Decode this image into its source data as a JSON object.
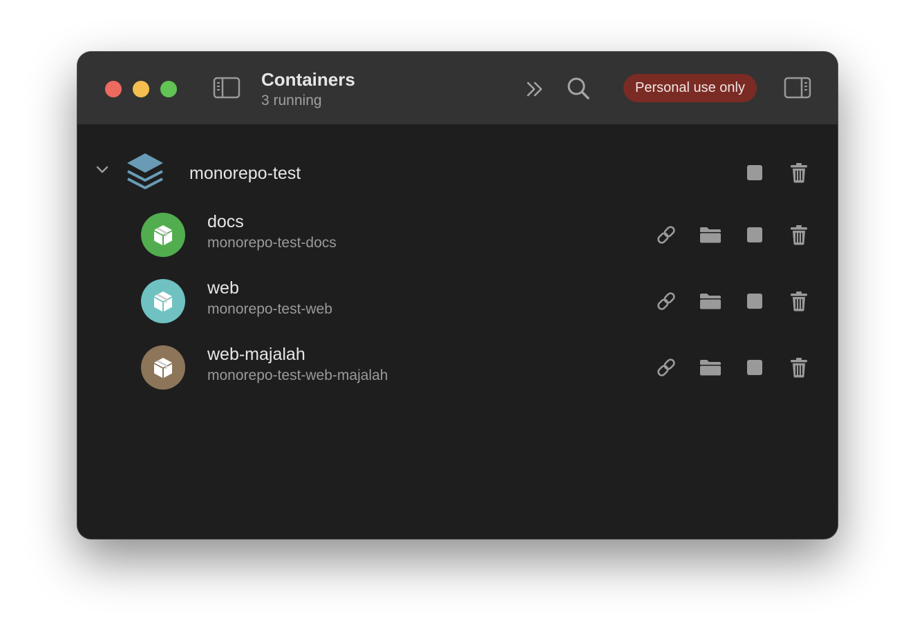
{
  "window": {
    "title": "Containers",
    "subtitle": "3 running",
    "badge": "Personal use only",
    "colors": {
      "badge_bg": "#7a2b24",
      "background": "#1e1e1e",
      "titlebar": "#333333"
    }
  },
  "toolbar": {
    "icons": [
      "sidebar-left-icon",
      "chevron-double-right-icon",
      "search-icon",
      "sidebar-right-icon"
    ]
  },
  "group": {
    "name": "monorepo-test",
    "icon": "stack-layers-icon",
    "actions": [
      "stop-icon",
      "trash-icon"
    ]
  },
  "containers": [
    {
      "name": "docs",
      "full_name": "monorepo-test-docs",
      "color": "#52ad4e"
    },
    {
      "name": "web",
      "full_name": "monorepo-test-web",
      "color": "#6fc2c1"
    },
    {
      "name": "web-majalah",
      "full_name": "monorepo-test-web-majalah",
      "color": "#8c7559"
    }
  ],
  "container_actions": [
    "link-icon",
    "folder-icon",
    "stop-icon",
    "trash-icon"
  ]
}
